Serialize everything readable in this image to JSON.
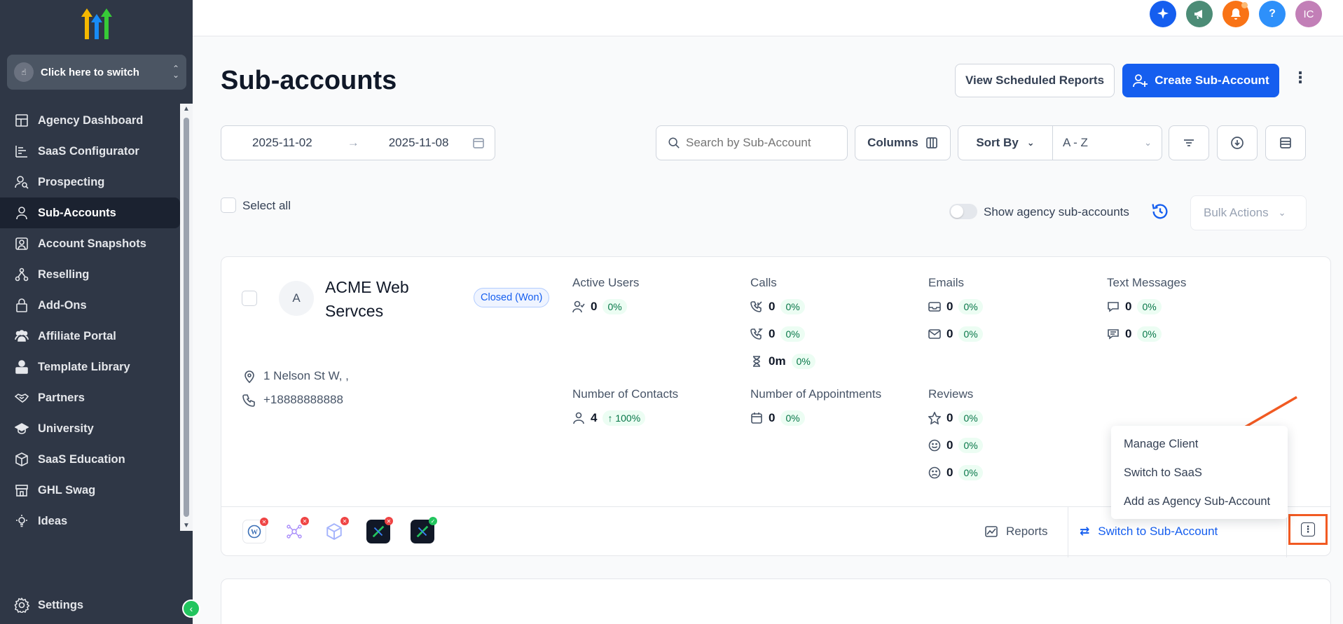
{
  "sidebar": {
    "switcher_label": "Click here to switch",
    "items": [
      {
        "label": "Agency Dashboard",
        "icon": "dashboard-icon"
      },
      {
        "label": "SaaS Configurator",
        "icon": "bar-chart-icon"
      },
      {
        "label": "Prospecting",
        "icon": "user-search-icon"
      },
      {
        "label": "Sub-Accounts",
        "icon": "user-icon"
      },
      {
        "label": "Account Snapshots",
        "icon": "snapshot-icon"
      },
      {
        "label": "Reselling",
        "icon": "reselling-icon"
      },
      {
        "label": "Add-Ons",
        "icon": "lock-bag-icon"
      },
      {
        "label": "Affiliate Portal",
        "icon": "users-icon"
      },
      {
        "label": "Template Library",
        "icon": "shapes-icon"
      },
      {
        "label": "Partners",
        "icon": "handshake-icon"
      },
      {
        "label": "University",
        "icon": "graduation-cap-icon"
      },
      {
        "label": "SaaS Education",
        "icon": "cube-icon"
      },
      {
        "label": "GHL Swag",
        "icon": "store-icon"
      },
      {
        "label": "Ideas",
        "icon": "lightbulb-icon"
      }
    ],
    "active_index": 3,
    "settings_label": "Settings"
  },
  "topbar": {
    "icons": [
      "sparkle-icon",
      "megaphone-icon",
      "bell-icon",
      "help-icon"
    ],
    "avatar_initials": "IC",
    "colors": {
      "sparkle": "#155eef",
      "megaphone": "#4c8c76",
      "bell": "#f97316",
      "help": "#2e90fa",
      "avatar": "#c27fb7"
    }
  },
  "page": {
    "title": "Sub-accounts",
    "view_reports_label": "View Scheduled Reports",
    "create_label": "Create Sub-Account",
    "date_start": "2025-11-02",
    "date_end": "2025-11-08",
    "search_placeholder": "Search by Sub-Account",
    "columns_label": "Columns",
    "sort_by_label": "Sort By",
    "sort_value": "A - Z",
    "select_all_label": "Select all",
    "show_agency_label": "Show agency sub-accounts",
    "bulk_actions_label": "Bulk Actions"
  },
  "account": {
    "initial": "A",
    "name": "ACME Web Servces",
    "status": "Closed (Won)",
    "address": "1 Nelson St W, ,",
    "phone": "+18888888888",
    "stats": {
      "active_users": {
        "title": "Active Users",
        "value": "0",
        "pct": "0%"
      },
      "calls": {
        "title": "Calls",
        "rows": [
          {
            "value": "0",
            "pct": "0%"
          },
          {
            "value": "0",
            "pct": "0%"
          },
          {
            "value": "0m",
            "pct": "0%"
          }
        ]
      },
      "emails": {
        "title": "Emails",
        "rows": [
          {
            "value": "0",
            "pct": "0%"
          },
          {
            "value": "0",
            "pct": "0%"
          }
        ]
      },
      "texts": {
        "title": "Text Messages",
        "rows": [
          {
            "value": "0",
            "pct": "0%"
          },
          {
            "value": "0",
            "pct": "0%"
          }
        ]
      },
      "contacts": {
        "title": "Number of Contacts",
        "value": "4",
        "pct": "100%"
      },
      "appointments": {
        "title": "Number of Appointments",
        "value": "0",
        "pct": "0%"
      },
      "reviews": {
        "title": "Reviews",
        "rows": [
          {
            "value": "0",
            "pct": "0%"
          },
          {
            "value": "0",
            "pct": "0%"
          },
          {
            "value": "0",
            "pct": "0%"
          }
        ]
      }
    },
    "reports_label": "Reports",
    "switch_label": "Switch to Sub-Account"
  },
  "menu": {
    "items": [
      "Manage Client",
      "Switch to SaaS",
      "Add as Agency Sub-Account"
    ]
  },
  "annotation_color": "#f15a22"
}
